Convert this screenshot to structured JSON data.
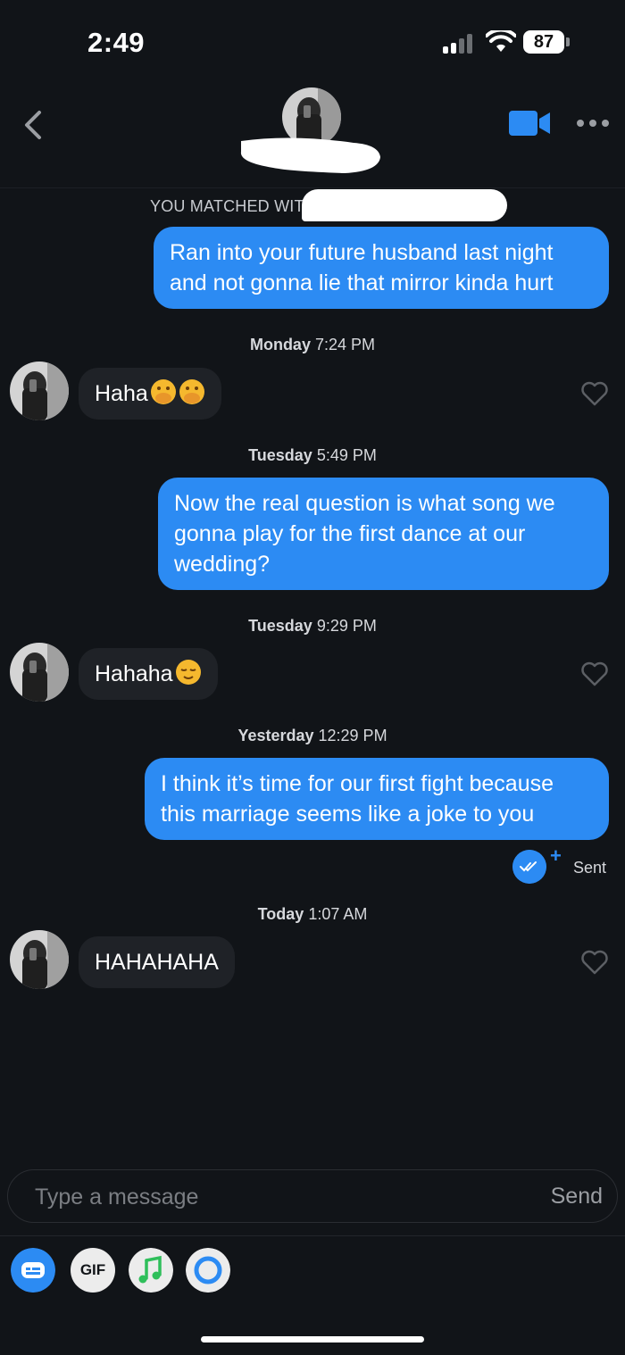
{
  "status_bar": {
    "time": "2:49",
    "battery": "87"
  },
  "header": {
    "back_icon": "chevron-left-icon",
    "video_icon": "video-camera-icon",
    "more_icon": "ellipsis-icon"
  },
  "match_banner": "YOU MATCHED WITH",
  "messages": [
    {
      "direction": "out",
      "text": "Ran into your future husband last night and not gonna lie that mirror kinda hurt"
    },
    {
      "timestamp_day": "Monday",
      "timestamp_time": "7:24 PM"
    },
    {
      "direction": "in",
      "text": "Haha",
      "emoji": [
        "face-with-hand-over-mouth",
        "face-with-hand-over-mouth"
      ]
    },
    {
      "timestamp_day": "Tuesday",
      "timestamp_time": "5:49 PM"
    },
    {
      "direction": "out",
      "text": "Now the real question is what song we gonna play for the first dance at our wedding?"
    },
    {
      "timestamp_day": "Tuesday",
      "timestamp_time": "9:29 PM"
    },
    {
      "direction": "in",
      "text": "Hahaha",
      "emoji": [
        "relieved-face"
      ]
    },
    {
      "timestamp_day": "Yesterday",
      "timestamp_time": "12:29 PM"
    },
    {
      "direction": "out",
      "text": "I think it’s time for our first fight because this marriage seems like a joke to you"
    },
    {
      "timestamp_day": "Today",
      "timestamp_time": "1:07 AM"
    },
    {
      "direction": "in",
      "text": "HAHAHAHA"
    }
  ],
  "sent_status": "Sent",
  "composer": {
    "placeholder": "Type a message",
    "send_label": "Send"
  },
  "toolbar": {
    "gif_label": "GIF",
    "icons": [
      "card-icon",
      "gif-icon",
      "music-note-icon",
      "ring-icon"
    ]
  },
  "colors": {
    "background": "#111418",
    "outgoing_bubble": "#2c8bf3",
    "incoming_bubble": "#1f2227",
    "accent": "#2c8bf3"
  }
}
